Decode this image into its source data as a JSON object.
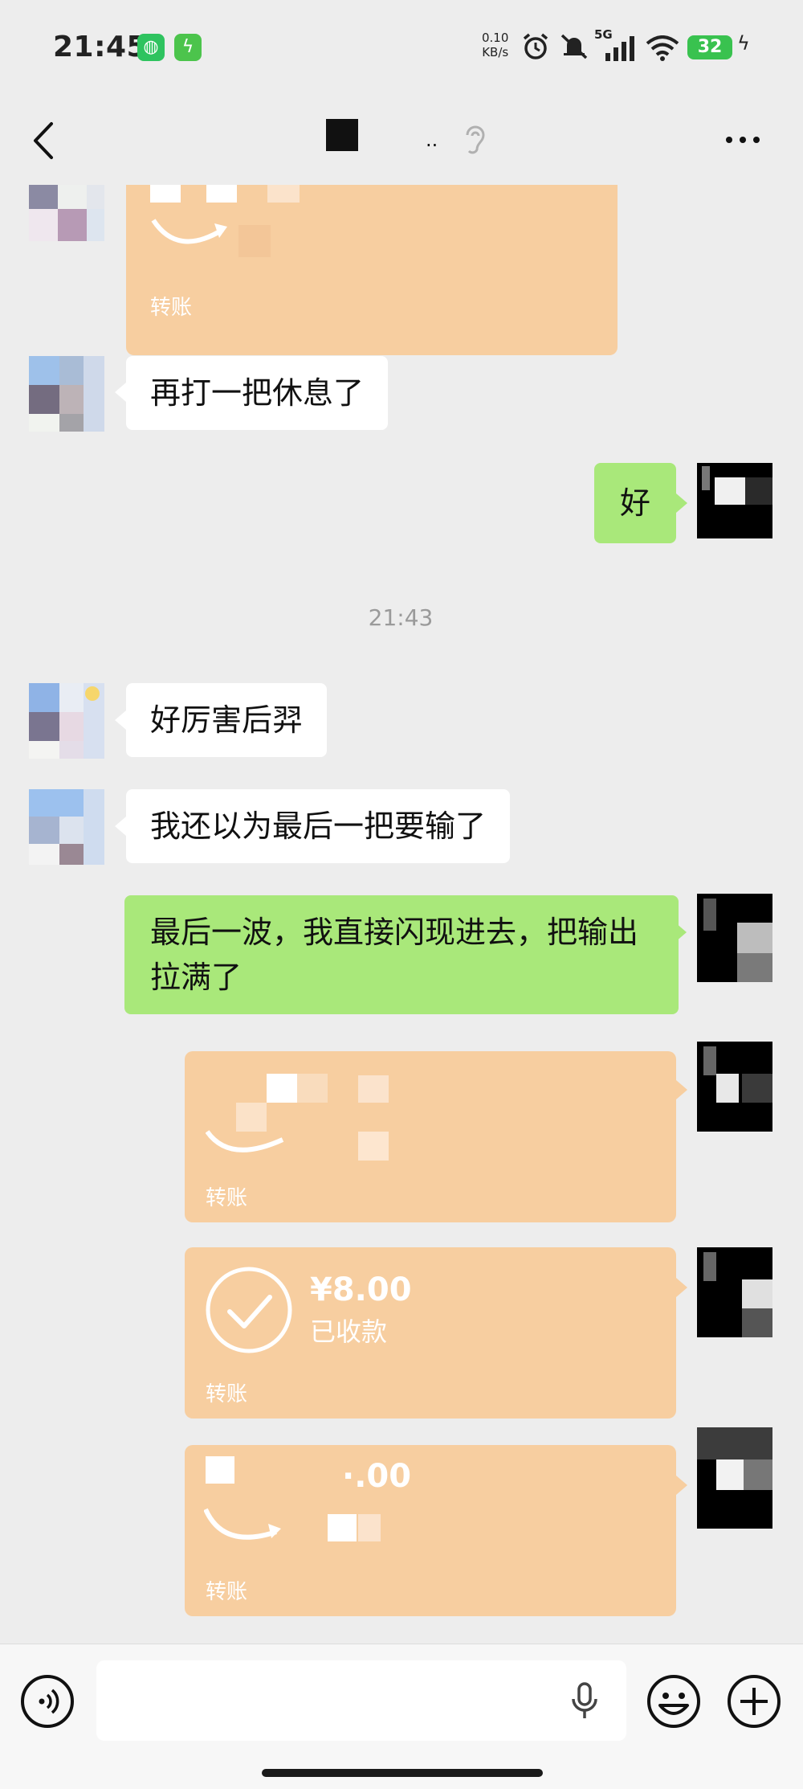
{
  "status_bar": {
    "time": "21:45",
    "net_speed_top": "0.10",
    "net_speed_bottom": "KB/s",
    "network": "5G",
    "battery": "32",
    "icons": [
      "wechat-icon",
      "charge-icon",
      "alarm-icon",
      "mute-icon",
      "signal-icon",
      "wifi-icon",
      "battery-icon"
    ]
  },
  "header": {
    "title_tail": "..",
    "icons": [
      "back-icon",
      "ear-icon",
      "more-icon"
    ]
  },
  "timestamp": "21:43",
  "messages": [
    {
      "side": "left",
      "type": "transfer",
      "label": "转账"
    },
    {
      "side": "left",
      "type": "text",
      "text": "再打一把休息了"
    },
    {
      "side": "right",
      "type": "text",
      "text": "好"
    },
    {
      "side": "left",
      "type": "text",
      "text": "好厉害后羿"
    },
    {
      "side": "left",
      "type": "text",
      "text": "我还以为最后一把要输了"
    },
    {
      "side": "right",
      "type": "text",
      "text": "最后一波，我直接闪现进去，把输出拉满了"
    },
    {
      "side": "right",
      "type": "transfer",
      "label": "转账"
    },
    {
      "side": "right",
      "type": "transfer",
      "amount": "¥8.00",
      "status": "已收款",
      "label": "转账"
    },
    {
      "side": "right",
      "type": "transfer",
      "amount_partial": "·.00",
      "label": "转账"
    }
  ],
  "bottom_bar": {
    "icons": [
      "voice-icon",
      "mic-icon",
      "emoji-icon",
      "plus-icon"
    ]
  },
  "colors": {
    "background": "#ededed",
    "green_bubble": "#a9e87a",
    "transfer": "#f7cea0",
    "white_bubble": "#ffffff"
  }
}
